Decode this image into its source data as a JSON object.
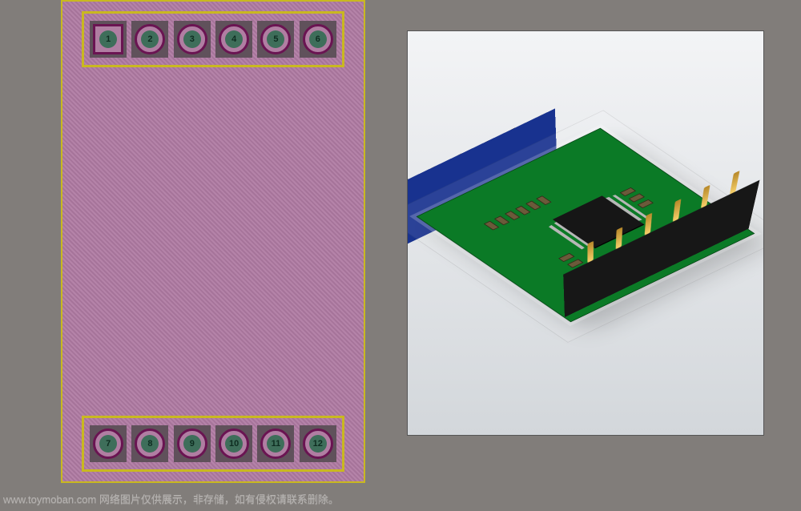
{
  "pcb2d": {
    "top_pins": [
      "1",
      "2",
      "3",
      "4",
      "5",
      "6"
    ],
    "bottom_pins": [
      "7",
      "8",
      "9",
      "10",
      "11",
      "12"
    ]
  },
  "watermark": {
    "text": "www.toymoban.com 网络图片仅供展示，非存储，如有侵权请联系删除。"
  },
  "colors": {
    "background": "#817d7a",
    "pcb_fill": "#af7aa2",
    "silk": "#c9b820",
    "ring": "#6a1452",
    "hole": "#3e6e5a",
    "board3d": "#0b7a26",
    "connector_blue": "#18328f",
    "connector_black": "#171717"
  }
}
